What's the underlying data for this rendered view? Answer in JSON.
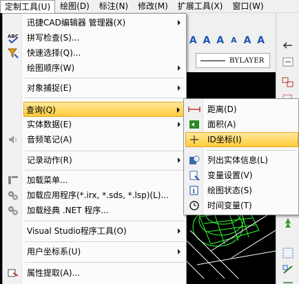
{
  "menubar": {
    "items": [
      {
        "label": "定制工具(U)",
        "active": true
      },
      {
        "label": "绘图(D)"
      },
      {
        "label": "标注(N)"
      },
      {
        "label": "修改(M)"
      },
      {
        "label": "扩展工具(X)"
      },
      {
        "label": "窗口(W)"
      }
    ]
  },
  "toolbar": {
    "linetype_value": "BYLAYER"
  },
  "menu": {
    "items": [
      {
        "label": "迅捷CAD编辑器 管理器(X)",
        "submenu": true,
        "icon": "none"
      },
      {
        "label": "拼写检查(S)...",
        "icon": "abc-spell-icon"
      },
      {
        "label": "快速选择(Q)...",
        "icon": "quick-select-funnel-icon"
      },
      {
        "label": "绘图顺序(W)",
        "submenu": true,
        "icon": "none"
      },
      {
        "label": "对象捕捉(E)",
        "submenu": true,
        "icon": "none"
      },
      {
        "label": "查询(Q)",
        "submenu": true,
        "icon": "none",
        "highlighted": true
      },
      {
        "label": "实体数据(E)",
        "submenu": true,
        "icon": "none"
      },
      {
        "label": "音频笔记(A)",
        "icon": "speaker-icon"
      },
      {
        "label": "记录动作(R)",
        "submenu": true,
        "icon": "none"
      },
      {
        "label": "加载菜单...",
        "icon": "load-menu-icon"
      },
      {
        "label": "加载应用程序(*.irx, *.sds, *.lsp)(L)...",
        "icon": "load-app-gear-icon"
      },
      {
        "label": "加载经典 .NET 程序...",
        "icon": "load-net-gear-icon"
      },
      {
        "label": "Visual Studio程序工具(O)",
        "submenu": true,
        "icon": "none"
      },
      {
        "label": "用户坐标系(U)",
        "submenu": true,
        "icon": "none"
      },
      {
        "label": "属性提取(A)...",
        "icon": "attribute-extract-icon"
      }
    ]
  },
  "submenu": {
    "items": [
      {
        "label": "距离(D)",
        "icon": "distance-icon"
      },
      {
        "label": "面积(A)",
        "icon": "area-icon"
      },
      {
        "label": "ID坐标(I)",
        "icon": "id-point-icon",
        "highlighted": true
      },
      {
        "label": "列出实体信息(L)",
        "icon": "list-info-icon"
      },
      {
        "label": "变量设置(V)",
        "icon": "variable-settings-icon"
      },
      {
        "label": "绘图状态(S)",
        "icon": "drawing-status-icon"
      },
      {
        "label": "时间变量(T)",
        "icon": "time-variable-icon"
      }
    ]
  },
  "colors": {
    "highlight_top": "#ffe79a",
    "highlight_bottom": "#ffcc3a",
    "highlight_border": "#e3a42a",
    "menu_bg": "#fbfbfb",
    "canvas_bg": "#000000",
    "wire_green": "#33ff33"
  }
}
